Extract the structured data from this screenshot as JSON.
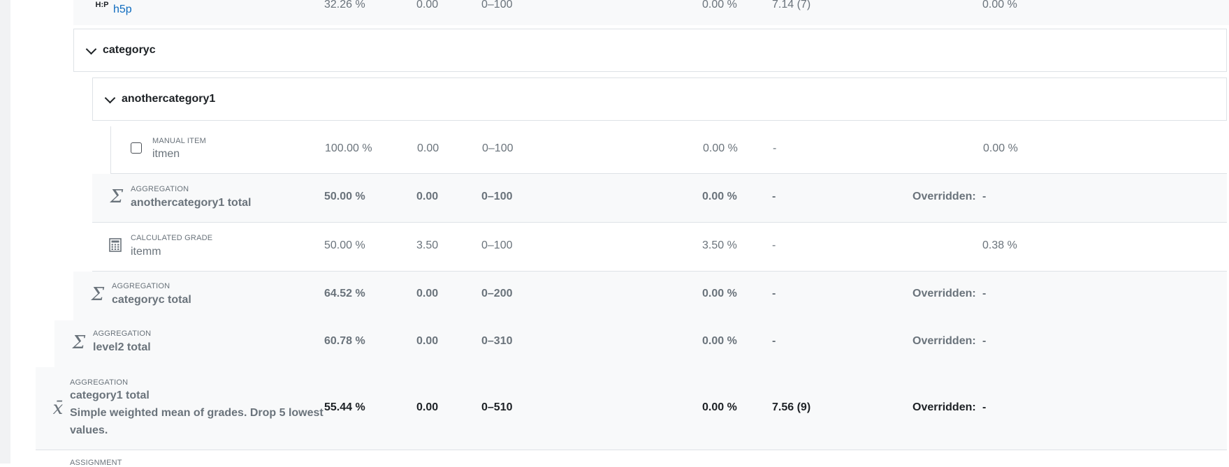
{
  "rows": {
    "h5p": {
      "icon": "h5p-icon",
      "icon_text": "H:P",
      "name": "h5p",
      "weight": "32.26 %",
      "grade": "0.00",
      "range": "0–100",
      "percentage": "0.00 %",
      "average": "7.14 (7)",
      "feedback": "",
      "contribution": "0.00 %"
    },
    "categoryc": {
      "title": "categoryc"
    },
    "anothercategory1": {
      "title": "anothercategory1"
    },
    "itmen": {
      "type": "MANUAL ITEM",
      "name": "itmen",
      "weight": "100.00 %",
      "grade": "0.00",
      "range": "0–100",
      "percentage": "0.00 %",
      "average": "-",
      "contribution": "0.00 %"
    },
    "anothercategory1_total": {
      "type": "AGGREGATION",
      "name": "anothercategory1 total",
      "weight": "50.00 %",
      "grade": "0.00",
      "range": "0–100",
      "percentage": "0.00 %",
      "average": "-",
      "feedback": "Overridden:",
      "contribution": "-"
    },
    "itemm": {
      "type": "CALCULATED GRADE",
      "name": "itemm",
      "weight": "50.00 %",
      "grade": "3.50",
      "range": "0–100",
      "percentage": "3.50 %",
      "average": "-",
      "contribution": "0.38 %"
    },
    "categoryc_total": {
      "type": "AGGREGATION",
      "name": "categoryc total",
      "weight": "64.52 %",
      "grade": "0.00",
      "range": "0–200",
      "percentage": "0.00 %",
      "average": "-",
      "feedback": "Overridden:",
      "contribution": "-"
    },
    "level2_total": {
      "type": "AGGREGATION",
      "name": "level2 total",
      "weight": "60.78 %",
      "grade": "0.00",
      "range": "0–310",
      "percentage": "0.00 %",
      "average": "-",
      "feedback": "Overridden:",
      "contribution": "-"
    },
    "category1_total": {
      "type": "AGGREGATION",
      "name": "category1 total",
      "desc1": "Simple weighted mean of grades. Drop 5 lowest",
      "desc2": "values.",
      "weight": "55.44 %",
      "grade": "0.00",
      "range": "0–510",
      "percentage": "0.00 %",
      "average": "7.56 (9)",
      "feedback": "Overridden:",
      "contribution": "-"
    },
    "next": {
      "type": "ASSIGNMENT"
    }
  },
  "icons": {
    "sigma": "Σ",
    "mean": "x̄"
  },
  "colors": {
    "link": "#0f6cbf",
    "muted": "#6a737b",
    "text": "#1d2125",
    "row_grey": "#f8f9fa",
    "border": "#dee2e6"
  }
}
